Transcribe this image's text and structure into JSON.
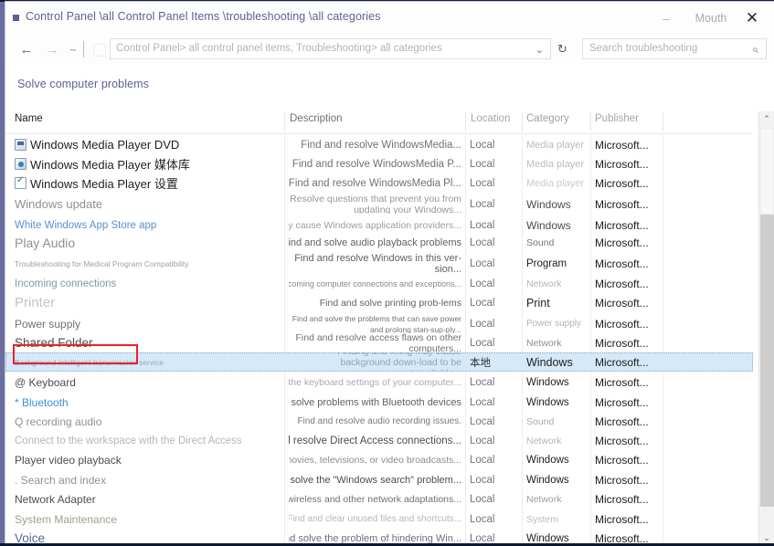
{
  "window": {
    "title": "Control Panel \\all Control Panel Items \\troubleshooting \\all categories",
    "minimize_label": "–",
    "maximize_label": "Mouth",
    "close_label": "✕"
  },
  "nav": {
    "back_icon": "←",
    "forward_icon": "→",
    "up_icon": "~",
    "address_value": "Control Panel> all control panel items, Troubleshooting> all categories",
    "address_chevron": "⌄",
    "refresh_icon": "↻",
    "search_placeholder": "Search troubleshooting",
    "search_icon": "⌕"
  },
  "task": {
    "solve_link": "Solve computer problems"
  },
  "columns": {
    "name": "Name",
    "description": "Description",
    "location": "Location",
    "category": "Category",
    "publisher": "Publisher"
  },
  "rows": [
    {
      "name": "Windows Media Player DVD",
      "icon": "media-dvd-icon",
      "desc": "Find and resolve WindowsMedia...",
      "location": "Local",
      "category": "Media player",
      "publisher": "Microsoft..."
    },
    {
      "name": "Windows Media Player 媒体库",
      "icon": "media-library-icon",
      "desc": "Find and resolve WindowsMedia P...",
      "location": "Local",
      "category": "Media player",
      "publisher": "Microsoft..."
    },
    {
      "name": "Windows Media Player 设置",
      "icon": "media-settings-icon",
      "desc": "Find and resolve WindowsMedia Pl...",
      "location": "Local",
      "category": "Media player",
      "publisher": "Microsoft..."
    },
    {
      "name": "Windows update",
      "desc": "Resolve questions that prevent you from updating your Windows...",
      "location": "Local",
      "category": "Windows",
      "publisher": "Microsoft..."
    },
    {
      "name": "White Windows App Store app",
      "desc": "The solution may cause Windows application providers...",
      "location": "Local",
      "category": "Windows",
      "publisher": "Microsoft..."
    },
    {
      "name": "Play Audio",
      "desc": "Find and solve audio playback problems",
      "location": "Local",
      "category": "Sound",
      "publisher": "Microsoft..."
    },
    {
      "name": "Troubleshooting for Medical Program Compatibility",
      "desc": "Find and resolve Windows in this ver-sion...",
      "location": "Local",
      "category": "Program",
      "publisher": "Microsoft..."
    },
    {
      "name": "Incoming connections",
      "desc": "Find and resolve incoming computer connections and exceptions...",
      "location": "Local",
      "category": "Network",
      "publisher": "Microsoft..."
    },
    {
      "name": "Printer",
      "desc": "Find and solve printing prob-lems",
      "location": "Local",
      "category": "Print",
      "publisher": "Microsoft..."
    },
    {
      "name": "Power supply",
      "desc": "Find and solve the problems that can save power and prolong stan-sup-ply...",
      "location": "Local",
      "category": "Power supply",
      "publisher": "Microsoft..."
    },
    {
      "name": "Shared Folder",
      "desc": "Find and resolve access flaws on other computers...",
      "location": "Local",
      "category": "Network",
      "publisher": "Microsoft..."
    },
    {
      "name": "Background intelligent transmission service",
      "desc": "Finding and fixing may cause background down-load to be unavailable...",
      "location": "本地",
      "category": "Windows",
      "publisher": "Microsoft...",
      "selected": true
    },
    {
      "name": "@ Keyboard",
      "desc": "Find and fix the keyboard settings of your computer...",
      "location": "Local",
      "category": "Windows",
      "publisher": "Microsoft..."
    },
    {
      "name": "* Bluetooth",
      "desc": "Find and solve problems with Bluetooth devices",
      "location": "Local",
      "category": "Windows",
      "publisher": "Microsoft..."
    },
    {
      "name": "Q recording audio",
      "desc": "Find and resolve audio recording issues.",
      "location": "Local",
      "category": "Sound",
      "publisher": "Microsoft..."
    },
    {
      "name": "Connect to the workspace with the Direct Access",
      "desc": "Find and resolve Direct Access connections...",
      "location": "Local",
      "category": "Network",
      "publisher": "Microsoft..."
    },
    {
      "name": "Player video playback",
      "desc": "Find and fix movies, televisions, or video broadcasts...",
      "location": "Local",
      "category": "Windows",
      "publisher": "Microsoft..."
    },
    {
      "name": ". Search and index",
      "desc": "Find and solve the \"Windows search\" problem...",
      "location": "Local",
      "category": "Windows",
      "publisher": "Microsoft..."
    },
    {
      "name": "Network Adapter",
      "desc": "Find and resolve wireless and other network adaptations...",
      "location": "Local",
      "category": "Network",
      "publisher": "Microsoft..."
    },
    {
      "name": "System Maintenance",
      "desc": "Find and clear unused files and shortcuts...",
      "location": "Local",
      "category": "System",
      "publisher": "Microsoft..."
    },
    {
      "name": "Voice",
      "desc": "Prepare the microphone and solve the problem of hindering Win...",
      "location": "Local",
      "category": "Windows",
      "publisher": "Microsoft..."
    }
  ],
  "scrollbar": {
    "up_icon": "⌃",
    "down_icon": "⌄"
  },
  "colors": {
    "selection": "#d6e9f8",
    "annotation": "#e8232a",
    "title_text": "#5e6294",
    "link": "#5d6194",
    "desktop": "#0d1b33"
  }
}
